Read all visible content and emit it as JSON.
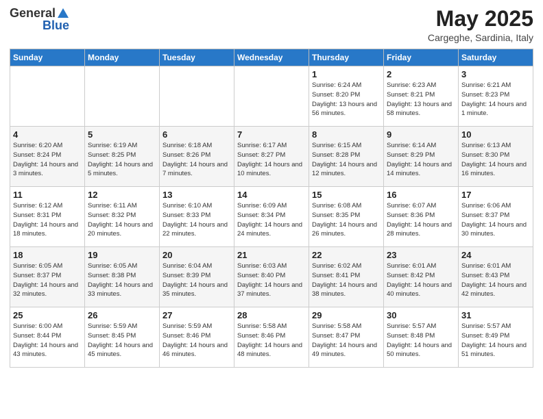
{
  "header": {
    "logo_general": "General",
    "logo_blue": "Blue",
    "month_year": "May 2025",
    "location": "Cargeghe, Sardinia, Italy"
  },
  "days_of_week": [
    "Sunday",
    "Monday",
    "Tuesday",
    "Wednesday",
    "Thursday",
    "Friday",
    "Saturday"
  ],
  "weeks": [
    [
      {
        "day": "",
        "info": ""
      },
      {
        "day": "",
        "info": ""
      },
      {
        "day": "",
        "info": ""
      },
      {
        "day": "",
        "info": ""
      },
      {
        "day": "1",
        "info": "Sunrise: 6:24 AM\nSunset: 8:20 PM\nDaylight: 13 hours and 56 minutes."
      },
      {
        "day": "2",
        "info": "Sunrise: 6:23 AM\nSunset: 8:21 PM\nDaylight: 13 hours and 58 minutes."
      },
      {
        "day": "3",
        "info": "Sunrise: 6:21 AM\nSunset: 8:23 PM\nDaylight: 14 hours and 1 minute."
      }
    ],
    [
      {
        "day": "4",
        "info": "Sunrise: 6:20 AM\nSunset: 8:24 PM\nDaylight: 14 hours and 3 minutes."
      },
      {
        "day": "5",
        "info": "Sunrise: 6:19 AM\nSunset: 8:25 PM\nDaylight: 14 hours and 5 minutes."
      },
      {
        "day": "6",
        "info": "Sunrise: 6:18 AM\nSunset: 8:26 PM\nDaylight: 14 hours and 7 minutes."
      },
      {
        "day": "7",
        "info": "Sunrise: 6:17 AM\nSunset: 8:27 PM\nDaylight: 14 hours and 10 minutes."
      },
      {
        "day": "8",
        "info": "Sunrise: 6:15 AM\nSunset: 8:28 PM\nDaylight: 14 hours and 12 minutes."
      },
      {
        "day": "9",
        "info": "Sunrise: 6:14 AM\nSunset: 8:29 PM\nDaylight: 14 hours and 14 minutes."
      },
      {
        "day": "10",
        "info": "Sunrise: 6:13 AM\nSunset: 8:30 PM\nDaylight: 14 hours and 16 minutes."
      }
    ],
    [
      {
        "day": "11",
        "info": "Sunrise: 6:12 AM\nSunset: 8:31 PM\nDaylight: 14 hours and 18 minutes."
      },
      {
        "day": "12",
        "info": "Sunrise: 6:11 AM\nSunset: 8:32 PM\nDaylight: 14 hours and 20 minutes."
      },
      {
        "day": "13",
        "info": "Sunrise: 6:10 AM\nSunset: 8:33 PM\nDaylight: 14 hours and 22 minutes."
      },
      {
        "day": "14",
        "info": "Sunrise: 6:09 AM\nSunset: 8:34 PM\nDaylight: 14 hours and 24 minutes."
      },
      {
        "day": "15",
        "info": "Sunrise: 6:08 AM\nSunset: 8:35 PM\nDaylight: 14 hours and 26 minutes."
      },
      {
        "day": "16",
        "info": "Sunrise: 6:07 AM\nSunset: 8:36 PM\nDaylight: 14 hours and 28 minutes."
      },
      {
        "day": "17",
        "info": "Sunrise: 6:06 AM\nSunset: 8:37 PM\nDaylight: 14 hours and 30 minutes."
      }
    ],
    [
      {
        "day": "18",
        "info": "Sunrise: 6:05 AM\nSunset: 8:37 PM\nDaylight: 14 hours and 32 minutes."
      },
      {
        "day": "19",
        "info": "Sunrise: 6:05 AM\nSunset: 8:38 PM\nDaylight: 14 hours and 33 minutes."
      },
      {
        "day": "20",
        "info": "Sunrise: 6:04 AM\nSunset: 8:39 PM\nDaylight: 14 hours and 35 minutes."
      },
      {
        "day": "21",
        "info": "Sunrise: 6:03 AM\nSunset: 8:40 PM\nDaylight: 14 hours and 37 minutes."
      },
      {
        "day": "22",
        "info": "Sunrise: 6:02 AM\nSunset: 8:41 PM\nDaylight: 14 hours and 38 minutes."
      },
      {
        "day": "23",
        "info": "Sunrise: 6:01 AM\nSunset: 8:42 PM\nDaylight: 14 hours and 40 minutes."
      },
      {
        "day": "24",
        "info": "Sunrise: 6:01 AM\nSunset: 8:43 PM\nDaylight: 14 hours and 42 minutes."
      }
    ],
    [
      {
        "day": "25",
        "info": "Sunrise: 6:00 AM\nSunset: 8:44 PM\nDaylight: 14 hours and 43 minutes."
      },
      {
        "day": "26",
        "info": "Sunrise: 5:59 AM\nSunset: 8:45 PM\nDaylight: 14 hours and 45 minutes."
      },
      {
        "day": "27",
        "info": "Sunrise: 5:59 AM\nSunset: 8:46 PM\nDaylight: 14 hours and 46 minutes."
      },
      {
        "day": "28",
        "info": "Sunrise: 5:58 AM\nSunset: 8:46 PM\nDaylight: 14 hours and 48 minutes."
      },
      {
        "day": "29",
        "info": "Sunrise: 5:58 AM\nSunset: 8:47 PM\nDaylight: 14 hours and 49 minutes."
      },
      {
        "day": "30",
        "info": "Sunrise: 5:57 AM\nSunset: 8:48 PM\nDaylight: 14 hours and 50 minutes."
      },
      {
        "day": "31",
        "info": "Sunrise: 5:57 AM\nSunset: 8:49 PM\nDaylight: 14 hours and 51 minutes."
      }
    ]
  ]
}
